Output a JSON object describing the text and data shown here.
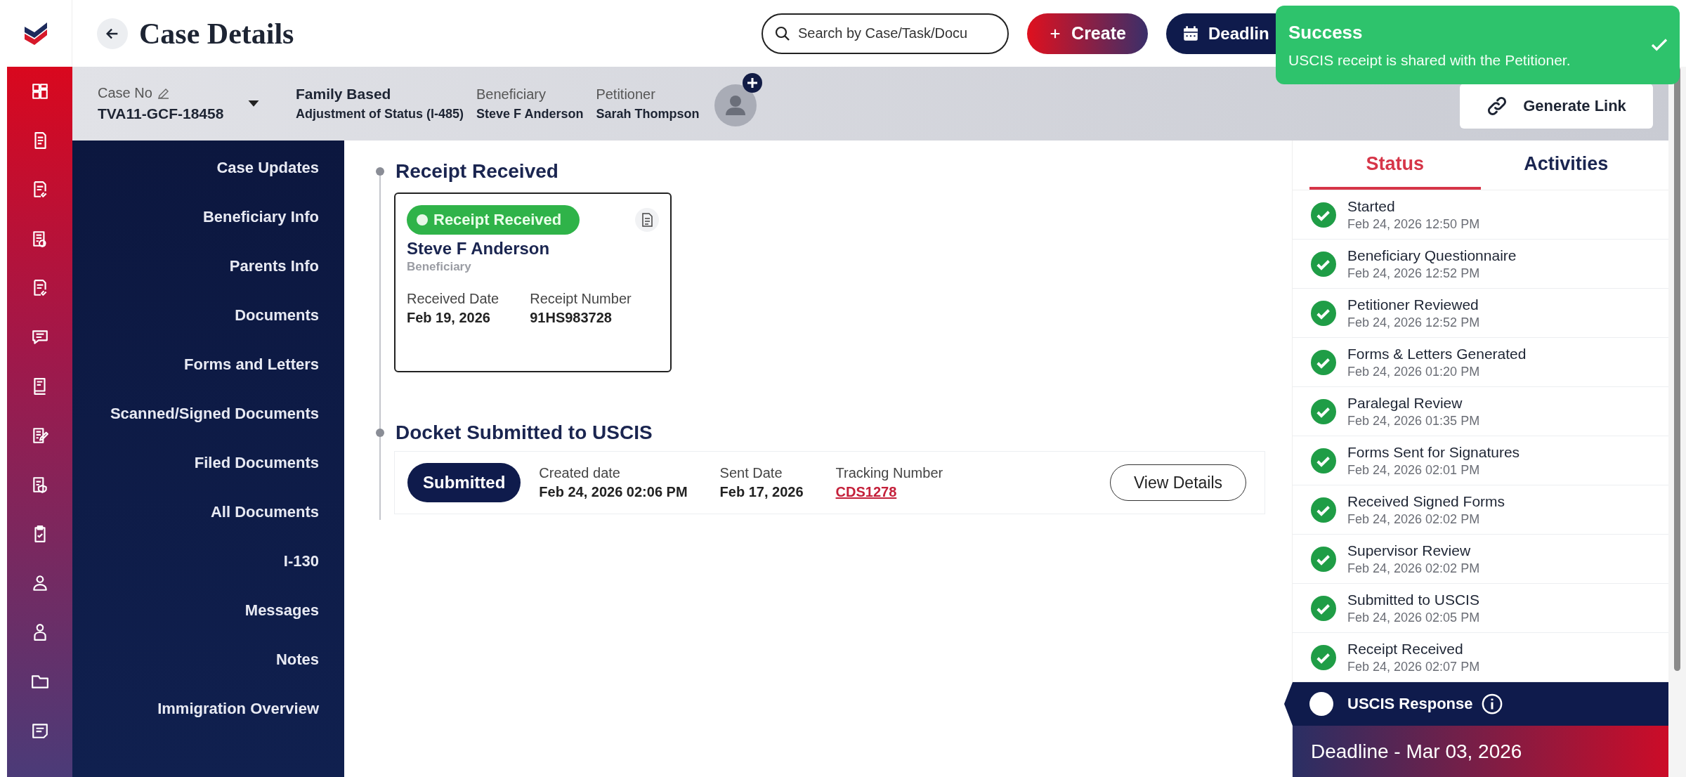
{
  "header": {
    "title": "Case Details",
    "search": {
      "placeholder": "Search by Case/Task/Docu"
    },
    "create_button": "Create",
    "deadline_button": "Deadlin"
  },
  "toast": {
    "title": "Success",
    "message": "USCIS receipt is shared with the Petitioner."
  },
  "case_bar": {
    "case_no_label": "Case No",
    "case_no": "TVA11-GCF-18458",
    "category": "Family Based",
    "subcategory": "Adjustment of Status (I-485)",
    "beneficiary_label": "Beneficiary",
    "beneficiary": "Steve F Anderson",
    "petitioner_label": "Petitioner",
    "petitioner": "Sarah Thompson",
    "generate_link": "Generate Link"
  },
  "nav": [
    "Case Updates",
    "Beneficiary Info",
    "Parents Info",
    "Documents",
    "Forms and Letters",
    "Scanned/Signed Documents",
    "Filed Documents",
    "All Documents",
    "I-130",
    "Messages",
    "Notes",
    "Immigration Overview"
  ],
  "timeline": [
    {
      "kind": "receipt",
      "heading": "Receipt Received",
      "badge": "Receipt Received",
      "name": "Steve F Anderson",
      "role": "Beneficiary",
      "fields": [
        {
          "label": "Received Date",
          "value": "Feb 19, 2026",
          "link": false
        },
        {
          "label": "Receipt Number",
          "value": "91HS983728",
          "link": false
        }
      ]
    },
    {
      "kind": "docket",
      "heading": "Docket Submitted to USCIS",
      "badge": "Submitted",
      "fields": [
        {
          "label": "Created date",
          "value": "Feb 24, 2026 02:06 PM",
          "link": false
        },
        {
          "label": "Sent Date",
          "value": "Feb 17, 2026",
          "link": false
        },
        {
          "label": "Tracking Number",
          "value": "CDS1278",
          "link": true
        }
      ],
      "button": "View Details"
    }
  ],
  "status_panel": {
    "tabs": [
      {
        "label": "Status",
        "selected": true
      },
      {
        "label": "Activities",
        "selected": false
      }
    ],
    "steps": [
      {
        "title": "Started",
        "time": "Feb 24, 2026 12:50 PM",
        "done": true
      },
      {
        "title": "Beneficiary Questionnaire",
        "time": "Feb 24, 2026 12:52 PM",
        "done": true
      },
      {
        "title": "Petitioner Reviewed",
        "time": "Feb 24, 2026 12:52 PM",
        "done": true
      },
      {
        "title": "Forms & Letters Generated",
        "time": "Feb 24, 2026 01:20 PM",
        "done": true
      },
      {
        "title": "Paralegal Review",
        "time": "Feb 24, 2026 01:35 PM",
        "done": true
      },
      {
        "title": "Forms Sent for Signatures",
        "time": "Feb 24, 2026 02:01 PM",
        "done": true
      },
      {
        "title": "Received Signed Forms",
        "time": "Feb 24, 2026 02:02 PM",
        "done": true
      },
      {
        "title": "Supervisor Review",
        "time": "Feb 24, 2026 02:02 PM",
        "done": true
      },
      {
        "title": "Submitted to USCIS",
        "time": "Feb 24, 2026 02:05 PM",
        "done": true
      },
      {
        "title": "Receipt Received",
        "time": "Feb 24, 2026 02:07 PM",
        "done": true
      }
    ],
    "uscis_response": "USCIS Response",
    "deadline": "Deadline - Mar 03, 2026"
  }
}
